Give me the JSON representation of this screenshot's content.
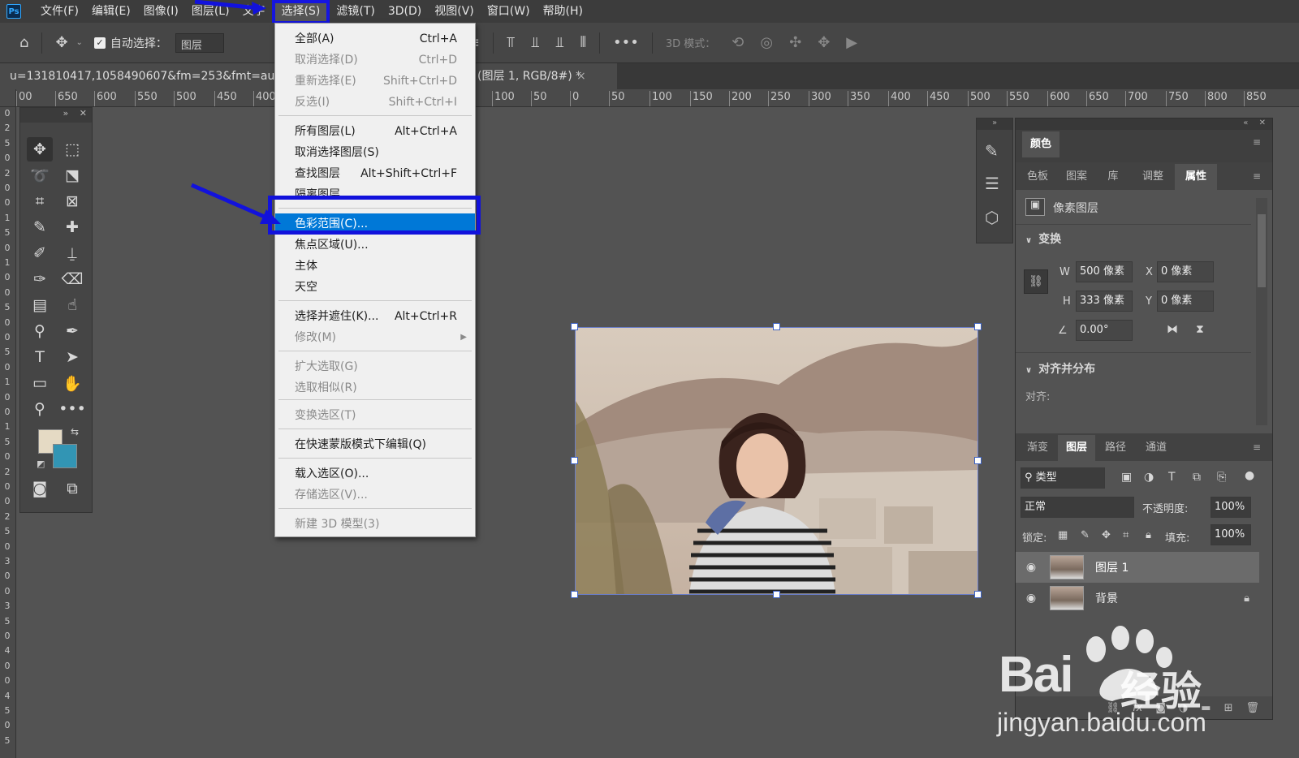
{
  "menubar": {
    "logo": "Ps",
    "items": [
      "文件(F)",
      "编辑(E)",
      "图像(I)",
      "图层(L)",
      "文字",
      "选择(S)",
      "滤镜(T)",
      "3D(D)",
      "视图(V)",
      "窗口(W)",
      "帮助(H)"
    ]
  },
  "options": {
    "auto_select_label": "自动选择：",
    "auto_select_target": "图层",
    "mode_3d": "3D 模式："
  },
  "tab": {
    "title_left": "u=131810417,1058490607&fm=253&fmt=auto&",
    "title_right": "(图层 1, RGB/8#) *",
    "close": "×"
  },
  "ruler": {
    "h_ticks": [
      "00",
      "650",
      "600",
      "550",
      "500",
      "450",
      "400",
      "100",
      "50",
      "0",
      "50",
      "100",
      "150",
      "200",
      "250",
      "300",
      "350",
      "400",
      "450",
      "500",
      "550",
      "600",
      "650",
      "700",
      "750",
      "800",
      "850"
    ],
    "v_ticks": [
      "0",
      "2",
      "5",
      "0",
      "2",
      "0",
      "0",
      "1",
      "5",
      "0",
      "1",
      "0",
      "0",
      "5",
      "0",
      "0",
      "5",
      "0",
      "1",
      "0",
      "0",
      "1",
      "5",
      "0",
      "2",
      "0",
      "0",
      "2",
      "5",
      "0",
      "3",
      "0",
      "0",
      "3",
      "5",
      "0",
      "4",
      "0",
      "0",
      "4",
      "5",
      "0",
      "5"
    ]
  },
  "dropdown": {
    "items": [
      {
        "label": "全部(A)",
        "shortcut": "Ctrl+A",
        "disabled": false
      },
      {
        "label": "取消选择(D)",
        "shortcut": "Ctrl+D",
        "disabled": true
      },
      {
        "label": "重新选择(E)",
        "shortcut": "Shift+Ctrl+D",
        "disabled": true
      },
      {
        "label": "反选(I)",
        "shortcut": "Shift+Ctrl+I",
        "disabled": true
      },
      {
        "label": "所有图层(L)",
        "shortcut": "Alt+Ctrl+A",
        "disabled": false
      },
      {
        "label": "取消选择图层(S)",
        "shortcut": "",
        "disabled": false
      },
      {
        "label": "查找图层",
        "shortcut": "Alt+Shift+Ctrl+F",
        "disabled": false
      },
      {
        "label": "隔离图层",
        "shortcut": "",
        "disabled": false
      },
      {
        "label": "色彩范围(C)...",
        "shortcut": "",
        "disabled": false
      },
      {
        "label": "焦点区域(U)...",
        "shortcut": "",
        "disabled": false
      },
      {
        "label": "主体",
        "shortcut": "",
        "disabled": false
      },
      {
        "label": "天空",
        "shortcut": "",
        "disabled": false
      },
      {
        "label": "选择并遮住(K)...",
        "shortcut": "Alt+Ctrl+R",
        "disabled": false
      },
      {
        "label": "修改(M)",
        "shortcut": "",
        "disabled": true
      },
      {
        "label": "扩大选取(G)",
        "shortcut": "",
        "disabled": true
      },
      {
        "label": "选取相似(R)",
        "shortcut": "",
        "disabled": true
      },
      {
        "label": "变换选区(T)",
        "shortcut": "",
        "disabled": true
      },
      {
        "label": "在快速蒙版模式下编辑(Q)",
        "shortcut": "",
        "disabled": false
      },
      {
        "label": "载入选区(O)...",
        "shortcut": "",
        "disabled": false
      },
      {
        "label": "存储选区(V)...",
        "shortcut": "",
        "disabled": true
      },
      {
        "label": "新建 3D 模型(3)",
        "shortcut": "",
        "disabled": true
      }
    ]
  },
  "panels": {
    "color_tab": "颜色",
    "tabs_row2": [
      "色板",
      "图案",
      "库",
      "调整",
      "属性"
    ],
    "pixel_layer": "像素图层",
    "transform": "变换",
    "w_label": "W",
    "h_label": "H",
    "x_label": "X",
    "y_label": "Y",
    "w_value": "500 像素",
    "h_value": "333 像素",
    "x_value": "0 像素",
    "y_value": "0 像素",
    "angle_value": "0.00°",
    "align_section": "对齐并分布",
    "align_label": "对齐:",
    "tabs_row3": [
      "渐变",
      "图层",
      "路径",
      "通道"
    ],
    "filter_kind": "类型",
    "blend_mode": "正常",
    "opacity_label": "不透明度:",
    "opacity_value": "100%",
    "lock_label": "锁定:",
    "fill_label": "填充:",
    "fill_value": "100%",
    "layers": [
      "图层 1",
      "背景"
    ]
  },
  "watermark": {
    "brand": "Bai",
    "brand_tail": "经验",
    "url": "jingyan.baidu.com"
  },
  "colors": {
    "foreground": "#e5dac4",
    "background": "#3295b4",
    "highlight": "#0078d7",
    "annotation": "#1212dc"
  }
}
